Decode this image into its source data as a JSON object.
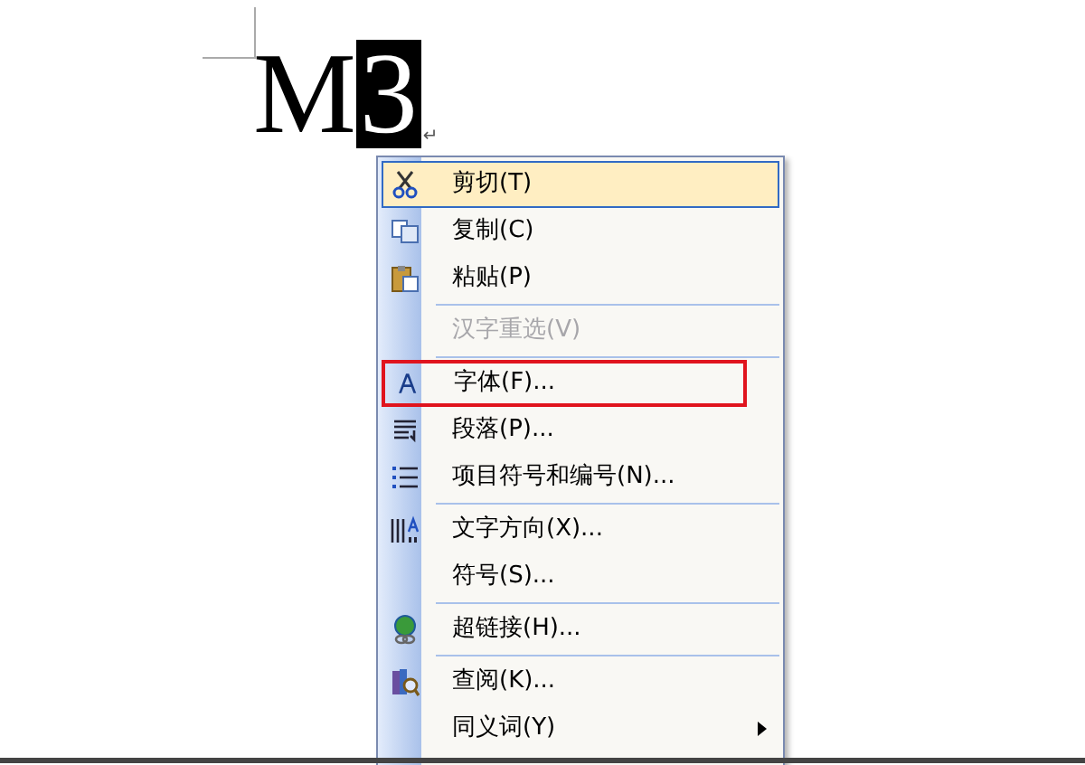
{
  "document": {
    "text": "M",
    "selected_text": "3",
    "paragraph_mark": "↵"
  },
  "context_menu": {
    "items": [
      {
        "kind": "item",
        "label": "剪切(T)",
        "selected": true,
        "disabled": false,
        "highlighted": false,
        "submenu": false
      },
      {
        "kind": "item",
        "label": "复制(C)",
        "selected": false,
        "disabled": false,
        "highlighted": false,
        "submenu": false
      },
      {
        "kind": "item",
        "label": "粘贴(P)",
        "selected": false,
        "disabled": false,
        "highlighted": false,
        "submenu": false
      },
      {
        "kind": "separator"
      },
      {
        "kind": "item",
        "label": "汉字重选(V)",
        "selected": false,
        "disabled": true,
        "highlighted": false,
        "submenu": false
      },
      {
        "kind": "separator"
      },
      {
        "kind": "item",
        "label": "字体(F)...",
        "selected": false,
        "disabled": false,
        "highlighted": true,
        "submenu": false
      },
      {
        "kind": "item",
        "label": "段落(P)...",
        "selected": false,
        "disabled": false,
        "highlighted": false,
        "submenu": false
      },
      {
        "kind": "item",
        "label": "项目符号和编号(N)...",
        "selected": false,
        "disabled": false,
        "highlighted": false,
        "submenu": false
      },
      {
        "kind": "separator"
      },
      {
        "kind": "item",
        "label": "文字方向(X)...",
        "selected": false,
        "disabled": false,
        "highlighted": false,
        "submenu": false
      },
      {
        "kind": "item",
        "label": "符号(S)...",
        "selected": false,
        "disabled": false,
        "highlighted": false,
        "submenu": false
      },
      {
        "kind": "separator"
      },
      {
        "kind": "item",
        "label": "超链接(H)...",
        "selected": false,
        "disabled": false,
        "highlighted": false,
        "submenu": false
      },
      {
        "kind": "separator"
      },
      {
        "kind": "item",
        "label": "查阅(K)...",
        "selected": false,
        "disabled": false,
        "highlighted": false,
        "submenu": false
      },
      {
        "kind": "item",
        "label": "同义词(Y)",
        "selected": false,
        "disabled": false,
        "highlighted": false,
        "submenu": true
      }
    ]
  }
}
